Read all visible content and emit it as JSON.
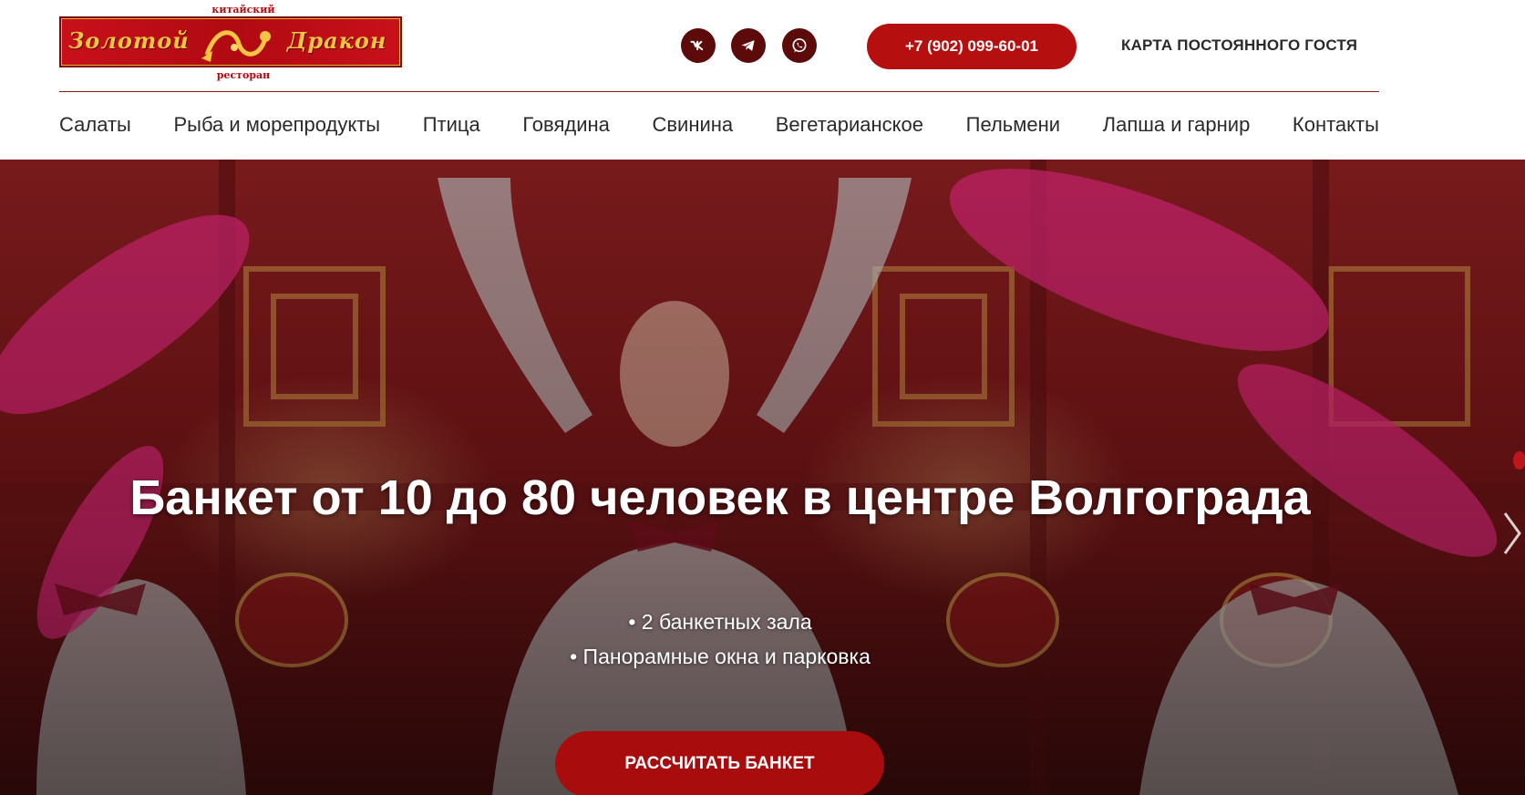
{
  "brand": {
    "name_left": "Золотой",
    "name_right": "Дракон",
    "arc_top": "китайский",
    "arc_bottom": "ресторан"
  },
  "header": {
    "social": [
      {
        "name": "vk",
        "icon": "vk-icon"
      },
      {
        "name": "telegram",
        "icon": "telegram-icon"
      },
      {
        "name": "whatsapp",
        "icon": "whatsapp-icon"
      }
    ],
    "phone": "+7 (902) 099-60-01",
    "guest_card": "КАРТА ПОСТОЯННОГО ГОСТЯ"
  },
  "nav": {
    "items": [
      "Салаты",
      "Рыба и морепродукты",
      "Птица",
      "Говядина",
      "Свинина",
      "Вегетарианское",
      "Пельмени",
      "Лапша и гарнир",
      "Контакты"
    ]
  },
  "hero": {
    "title": "Банкет от 10 до 80 человек в центре Волгограда",
    "bullets": [
      "• 2 банкетных зала",
      "• Панорамные окна и парковка"
    ],
    "cta": "РАССЧИТАТЬ БАНКЕТ"
  },
  "colors": {
    "accent": "#b60f0f",
    "dark_red": "#5c0a0a",
    "gold": "#f4c542"
  }
}
